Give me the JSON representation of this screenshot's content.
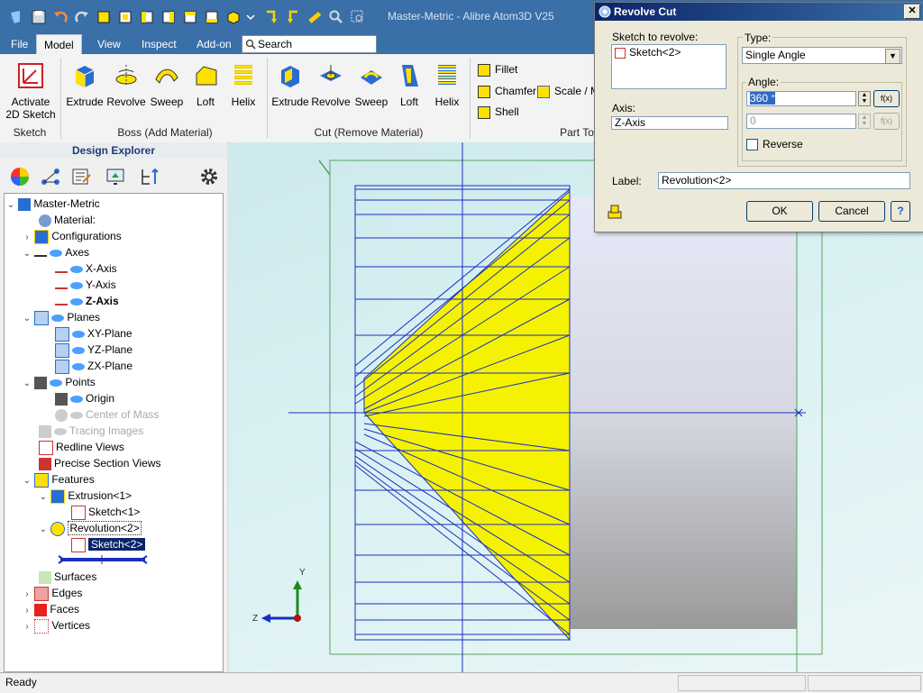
{
  "titlebar": {
    "title": "Master-Metric - Alibre Atom3D V25"
  },
  "menu": {
    "tabs": [
      {
        "label": "File"
      },
      {
        "label": "Model"
      },
      {
        "label": "View"
      },
      {
        "label": "Inspect"
      },
      {
        "label": "Add-on"
      }
    ],
    "search_placeholder": "Search"
  },
  "ribbon": {
    "sketch_group": {
      "label": "Sketch",
      "activate_label_1": "Activate",
      "activate_label_2": "2D Sketch"
    },
    "boss_group": {
      "label": "Boss (Add Material)",
      "buttons": [
        "Extrude",
        "Revolve",
        "Sweep",
        "Loft",
        "Helix"
      ]
    },
    "cut_group": {
      "label": "Cut (Remove Material)",
      "buttons": [
        "Extrude",
        "Revolve",
        "Sweep",
        "Loft",
        "Helix"
      ]
    },
    "part_tools_group": {
      "label": "Part To",
      "fillet": "Fillet",
      "chamfer": "Chamfer",
      "shell": "Shell",
      "scale": "Scale / M"
    }
  },
  "explorer": {
    "title": "Design Explorer",
    "tree": [
      {
        "label": "Master-Metric"
      },
      {
        "label": "Material:"
      },
      {
        "label": "Configurations"
      },
      {
        "label": "Axes"
      },
      {
        "label": "X-Axis"
      },
      {
        "label": "Y-Axis"
      },
      {
        "label": "Z-Axis"
      },
      {
        "label": "Planes"
      },
      {
        "label": "XY-Plane"
      },
      {
        "label": "YZ-Plane"
      },
      {
        "label": "ZX-Plane"
      },
      {
        "label": "Points"
      },
      {
        "label": "Origin"
      },
      {
        "label": "Center of Mass"
      },
      {
        "label": "Tracing Images"
      },
      {
        "label": "Redline Views"
      },
      {
        "label": "Precise Section Views"
      },
      {
        "label": "Features"
      },
      {
        "label": "Extrusion<1>"
      },
      {
        "label": "Sketch<1>"
      },
      {
        "label": "Revolution<2>"
      },
      {
        "label": "Sketch<2>"
      },
      {
        "label": "Surfaces"
      },
      {
        "label": "Edges"
      },
      {
        "label": "Faces"
      },
      {
        "label": "Vertices"
      }
    ]
  },
  "viewport": {
    "axis_y": "Y",
    "axis_z": "Z"
  },
  "status": {
    "text": "Ready"
  },
  "dialog": {
    "title": "Revolve Cut",
    "sketch_label": "Sketch to revolve:",
    "sketch_item": "Sketch<2>",
    "axis_label": "Axis:",
    "axis_value": "Z-Axis",
    "type_label": "Type:",
    "type_value": "Single Angle",
    "angle_label": "Angle:",
    "angle_value": "360 °",
    "angle2_value": "0",
    "fx_label": "f(x)",
    "reverse_label": "Reverse",
    "label_label": "Label:",
    "label_value": "Revolution<2>",
    "ok": "OK",
    "cancel": "Cancel",
    "help": "?"
  },
  "colors": {
    "accent": "#3a6fa8",
    "sketch_blue": "#1a2fbf",
    "fill_yellow": "#f5f200",
    "construction_green": "#5aa25a"
  }
}
